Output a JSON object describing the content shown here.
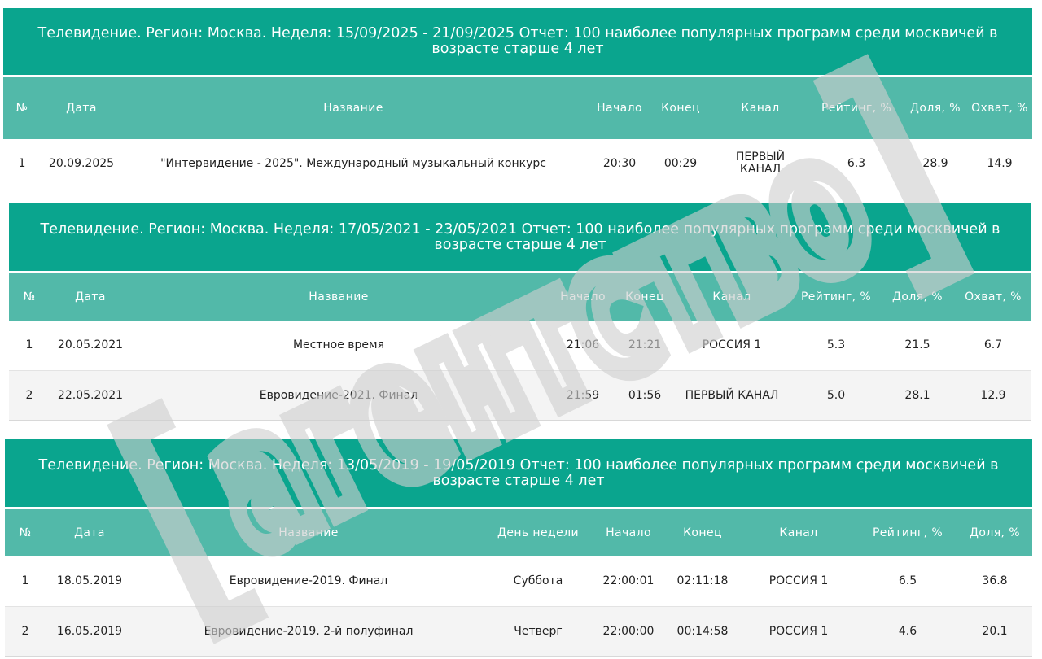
{
  "tables": [
    {
      "title": "Телевидение. Регион: Москва. Неделя: 15/09/2025 - 21/09/2025 Отчет: 100 наиболее популярных программ среди москвичей в возрасте старше 4 лет",
      "headers": [
        "№",
        "Дата",
        "Название",
        "Начало",
        "Конец",
        "Канал",
        "Рейтинг, %",
        "Доля, %",
        "Охват, %"
      ],
      "rows": [
        [
          "1",
          "20.09.2025",
          "\"Интервидение - 2025\". Международный музыкальный конкурс",
          "20:30",
          "00:29",
          "ПЕРВЫЙ КАНАЛ",
          "6.3",
          "28.9",
          "14.9"
        ]
      ]
    },
    {
      "title": "Телевидение. Регион: Москва. Неделя: 17/05/2021 - 23/05/2021 Отчет: 100 наиболее популярных программ среди москвичей в возрасте старше 4 лет",
      "headers": [
        "№",
        "Дата",
        "Название",
        "Начало",
        "Конец",
        "Канал",
        "Рейтинг, %",
        "Доля, %",
        "Охват, %"
      ],
      "rows": [
        [
          "1",
          "20.05.2021",
          "Местное время",
          "21:06",
          "21:21",
          "РОССИЯ 1",
          "5.3",
          "21.5",
          "6.7"
        ],
        [
          "2",
          "22.05.2021",
          "Евровидение-2021. Финал",
          "21:59",
          "01:56",
          "ПЕРВЫЙ КАНАЛ",
          "5.0",
          "28.1",
          "12.9"
        ]
      ]
    },
    {
      "title": "Телевидение. Регион: Москва. Неделя: 13/05/2019 - 19/05/2019 Отчет: 100 наиболее популярных программ среди москвичей в возрасте старше 4 лет",
      "headers": [
        "№",
        "Дата",
        "Название",
        "День недели",
        "Начало",
        "Конец",
        "Канал",
        "Рейтинг, %",
        "Доля, %"
      ],
      "rows": [
        [
          "1",
          "18.05.2019",
          "Евровидение-2019. Финал",
          "Суббота",
          "22:00:01",
          "02:11:18",
          "РОССИЯ 1",
          "6.5",
          "36.8"
        ],
        [
          "2",
          "16.05.2019",
          "Евровидение-2019. 2-й полуфинал",
          "Четверг",
          "22:00:00",
          "00:14:58",
          "РОССИЯ 1",
          "4.6",
          "20.1"
        ]
      ]
    }
  ],
  "watermark": {
    "text": "агентство",
    "color": "#cfcfcf"
  }
}
